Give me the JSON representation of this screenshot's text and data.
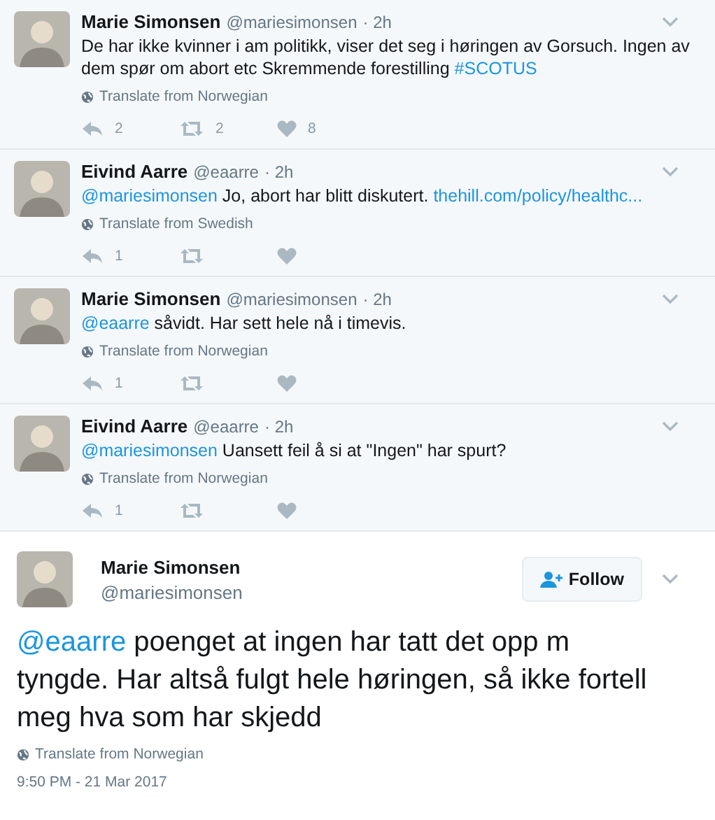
{
  "thread": [
    {
      "name": "Marie Simonsen",
      "handle": "@mariesimonsen",
      "time": "· 2h",
      "text": [
        {
          "kind": "text",
          "text": "De har ikke kvinner i am politikk, viser det seg i høringen av Gorsuch. Ingen av dem spør om abort etc Skremmende forestilling "
        },
        {
          "kind": "link",
          "text": "#SCOTUS"
        }
      ],
      "translate": "Translate from Norwegian",
      "replies": "2",
      "retweets": "2",
      "likes": "8"
    },
    {
      "name": "Eivind Aarre",
      "handle": "@eaarre",
      "time": "· 2h",
      "text": [
        {
          "kind": "link",
          "text": "@mariesimonsen"
        },
        {
          "kind": "text",
          "text": " Jo, abort har blitt diskutert. "
        },
        {
          "kind": "link",
          "text": "thehill.com/policy/healthc..."
        }
      ],
      "translate": "Translate from Swedish",
      "replies": "1"
    },
    {
      "name": "Marie Simonsen",
      "handle": "@mariesimonsen",
      "time": "· 2h",
      "text": [
        {
          "kind": "link",
          "text": "@eaarre"
        },
        {
          "kind": "text",
          "text": " såvidt. Har sett hele nå i timevis."
        }
      ],
      "translate": "Translate from Norwegian",
      "replies": "1"
    },
    {
      "name": "Eivind Aarre",
      "handle": "@eaarre",
      "time": "· 2h",
      "text": [
        {
          "kind": "link",
          "text": "@mariesimonsen"
        },
        {
          "kind": "text",
          "text": " Uansett feil å si at \"Ingen\" har spurt?"
        }
      ],
      "translate": "Translate from Norwegian",
      "replies": "1"
    }
  ],
  "main": {
    "name": "Marie Simonsen",
    "handle": "@mariesimonsen",
    "follow": "Follow",
    "text": [
      {
        "kind": "link",
        "text": "@eaarre"
      },
      {
        "kind": "text",
        "text": " poenget at ingen har tatt det opp m tyngde. Har altså fulgt hele høringen, så ikke fortell meg hva som har skjedd"
      }
    ],
    "translate": "Translate from Norwegian",
    "timestamp": "9:50 PM - 21 Mar 2017"
  }
}
